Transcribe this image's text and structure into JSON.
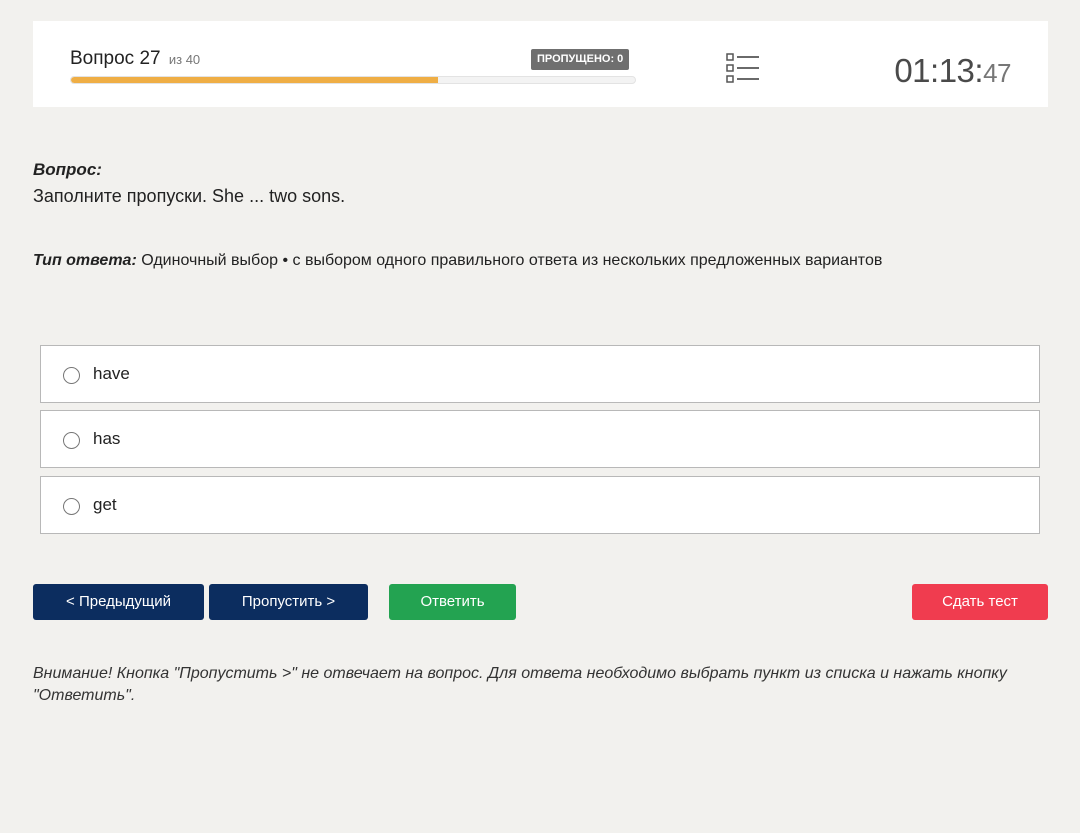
{
  "header": {
    "question_label": "Вопрос 27",
    "question_of": "из 40",
    "skipped_badge": "ПРОПУЩЕНО: 0",
    "progress_fraction": 0.65,
    "progress_color": "#efae45",
    "list_icon": "list-icon",
    "timer_main": "01:13:",
    "timer_seconds": "47"
  },
  "question": {
    "title": "Вопрос:",
    "text": "Заполните пропуски. She ... two sons."
  },
  "answer_type": {
    "label": "Тип ответа:",
    "value": "Одиночный выбор • с выбором одного правильного ответа из нескольких предложенных вариантов"
  },
  "options": [
    {
      "label": "have",
      "selected": false
    },
    {
      "label": "has",
      "selected": false
    },
    {
      "label": "get",
      "selected": false
    }
  ],
  "buttons": {
    "prev": "< Предыдущий",
    "skip": "Пропустить >",
    "answer": "Ответить",
    "submit": "Сдать тест"
  },
  "colors": {
    "nav_button": "#0c2d5f",
    "answer_button": "#23a351",
    "submit_button": "#f03c4f"
  },
  "note": "Внимание! Кнопка \"Пропустить >\" не отвечает на вопрос. Для ответа необходимо выбрать пункт из списка и нажать кнопку \"Ответить\"."
}
